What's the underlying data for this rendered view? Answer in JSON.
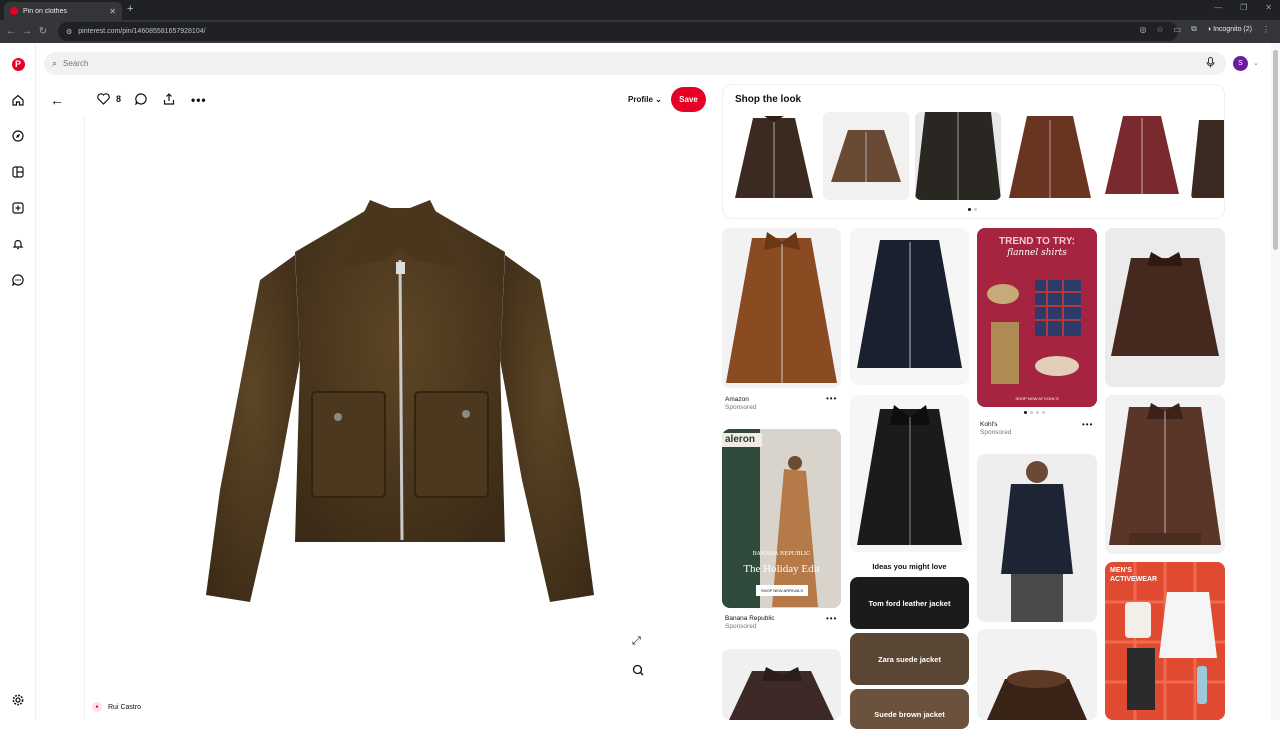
{
  "browser": {
    "tab_title": "Pin on clothes",
    "url": "pinterest.com/pin/146085581657928104/",
    "incognito_label": "Incognito (2)"
  },
  "header": {
    "search_placeholder": "Search",
    "avatar_initial": "S"
  },
  "pin": {
    "like_count": "8",
    "profile_label": "Profile",
    "save_label": "Save",
    "author": "Rui Castro"
  },
  "shop_the_look": {
    "title": "Shop the look"
  },
  "grid": {
    "amazon": {
      "source": "Amazon",
      "tag": "Sponsored"
    },
    "kohls": {
      "source": "Kohl's",
      "tag": "Sponsored",
      "headline": "TREND TO TRY:",
      "script": "flannel shirts",
      "cta": "SHOP NOW AT KOHL'S"
    },
    "banana": {
      "source": "Banana Republic",
      "tag": "Sponsored",
      "brand": "BANANA REPUBLIC",
      "headline": "The Holiday Edit",
      "cta": "SHOP NEW ARRIVALS",
      "sign": "aleron"
    },
    "mens": {
      "line1": "MEN'S",
      "line2": "ACTIVEWEAR"
    },
    "ideas_title": "Ideas you might love",
    "ideas": [
      "Tom ford leather jacket",
      "Zara suede jacket",
      "Suede brown jacket"
    ]
  },
  "colors": {
    "brand": "#e60023",
    "avatar": "#6c1b9e"
  }
}
